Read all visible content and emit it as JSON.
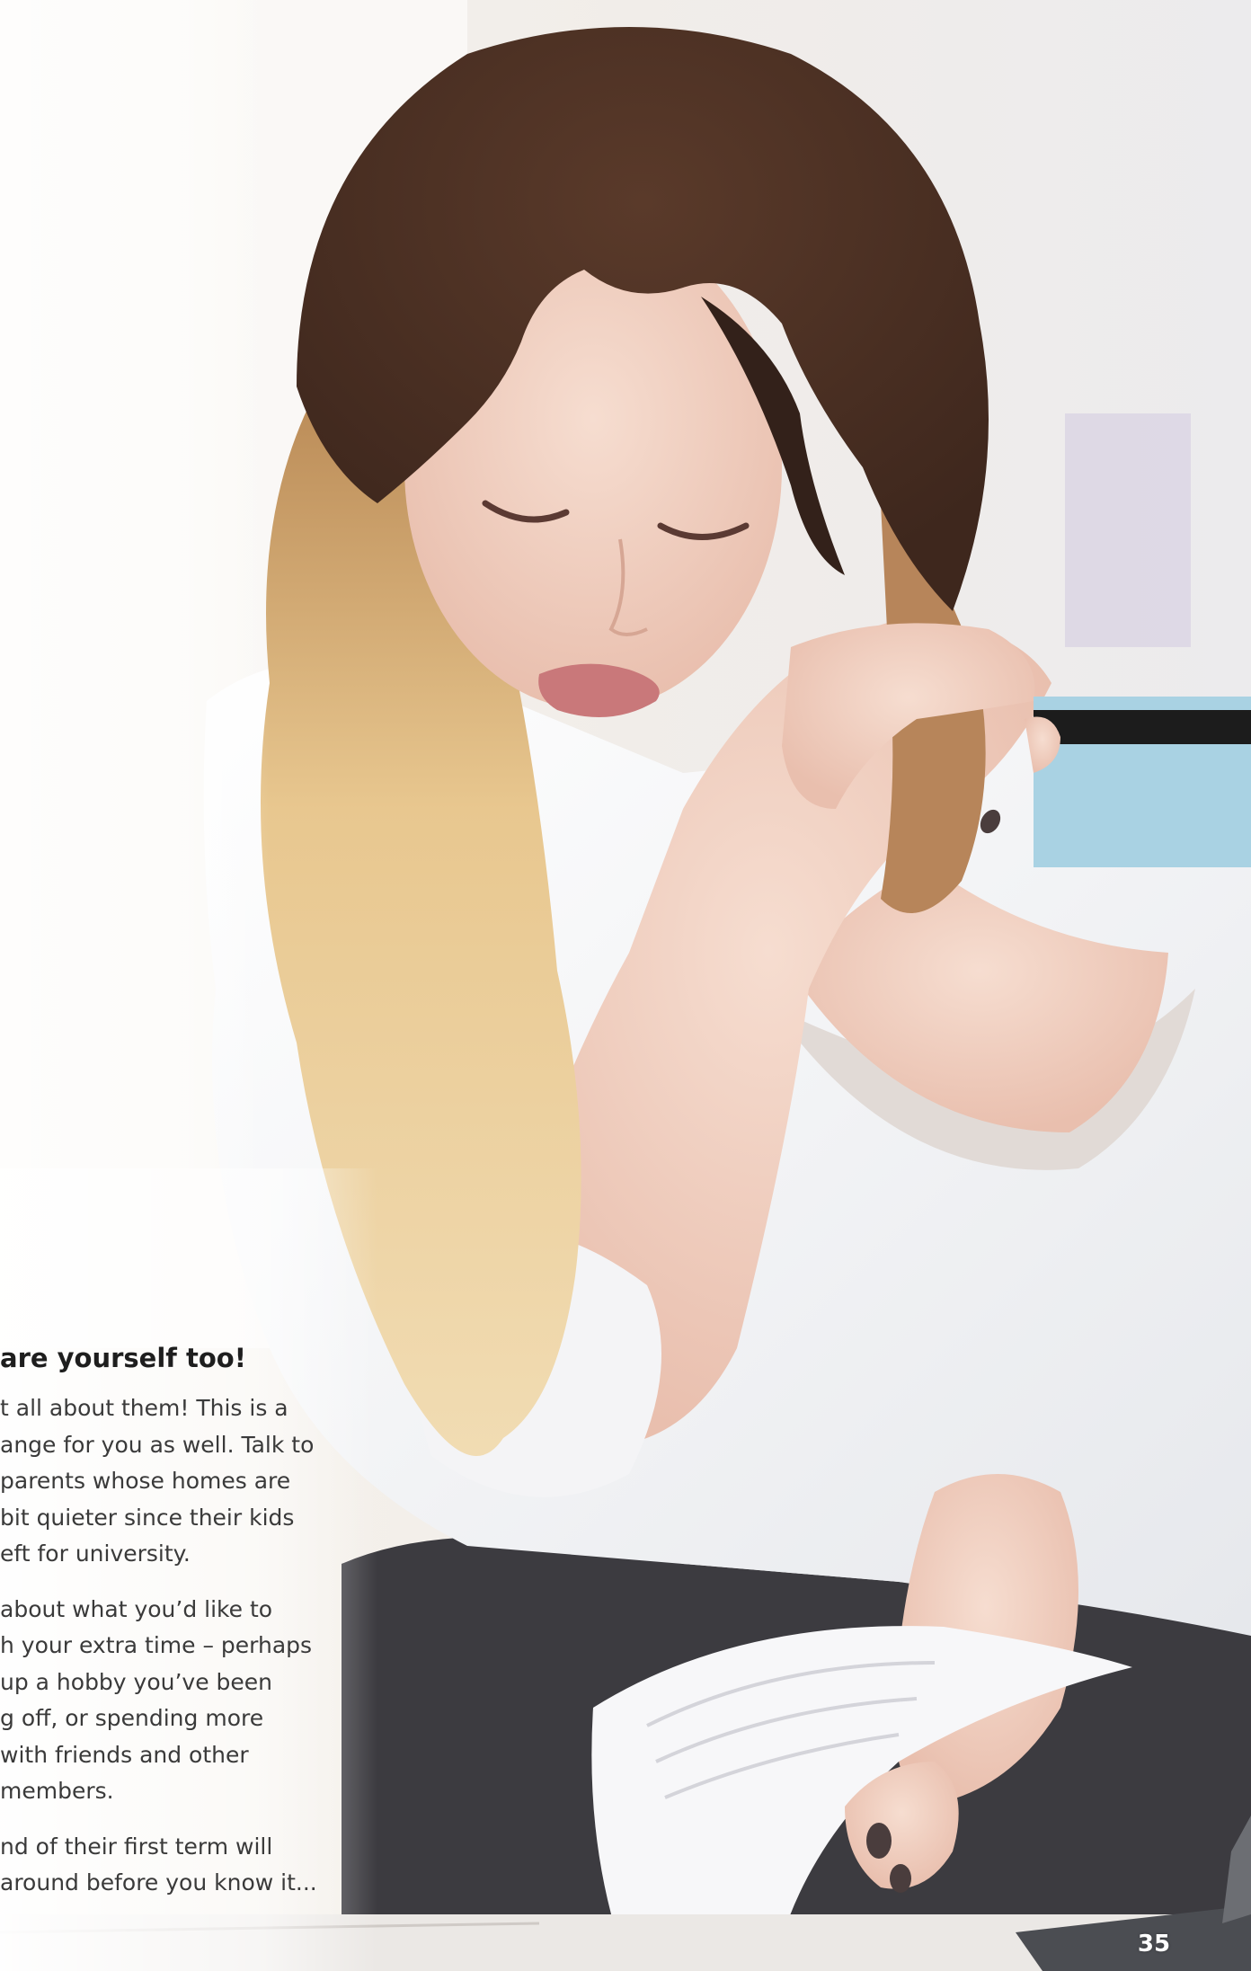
{
  "section": {
    "heading": "are yourself too!",
    "paragraphs": [
      {
        "lines": [
          "t all about them! This is a",
          "ange for you as well. Talk to",
          "parents whose homes are",
          "bit quieter since their kids",
          "eft for university."
        ]
      },
      {
        "lines": [
          "about what you’d like to",
          "h your extra time – perhaps",
          " up a hobby you’ve been",
          "g off, or spending more",
          "with friends and other",
          " members."
        ]
      },
      {
        "lines": [
          "nd of their first term will",
          "around before you know it..."
        ]
      }
    ]
  },
  "page_number": "35",
  "photo": {
    "icon": "photo-woman-with-card-and-documents",
    "colors": {
      "background": "#f6f3ef",
      "hair_dark": "#4a2f22",
      "hair_light": "#e7c489",
      "skin": "#f1d2c4",
      "blouse": "#f2f2f2",
      "trousers": "#3c3b40",
      "card": "#a9d2e3",
      "card_stripe": "#1c1c1c"
    }
  }
}
